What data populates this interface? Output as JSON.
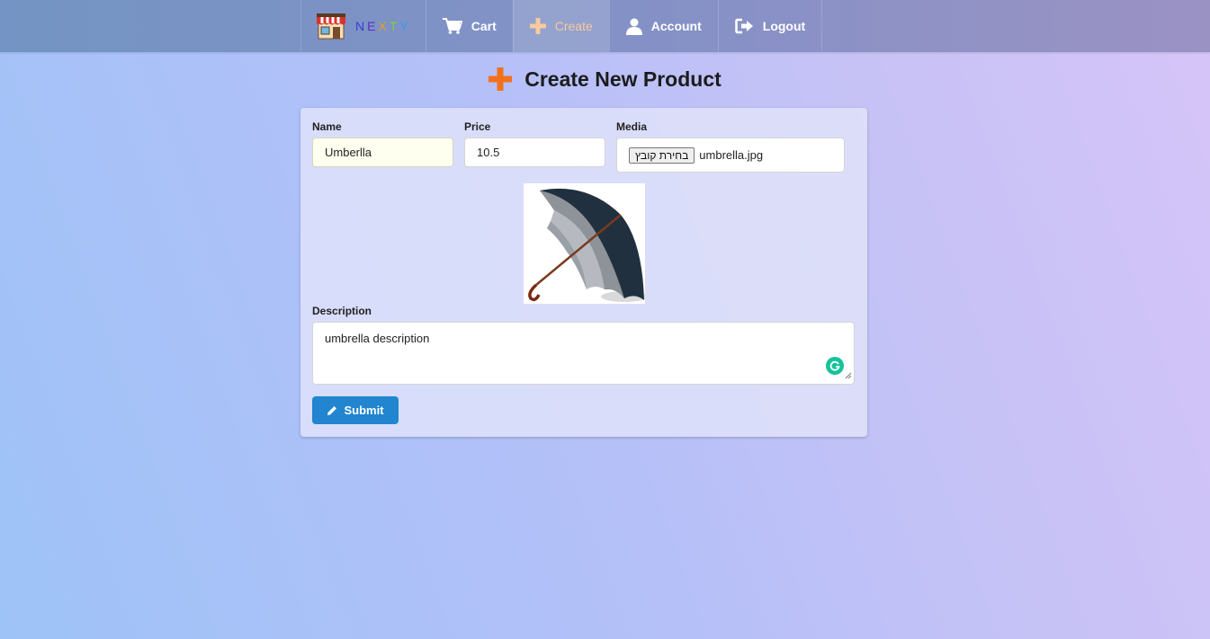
{
  "nav": {
    "brand_letters": [
      "N",
      "E",
      "X",
      "T",
      "Y"
    ],
    "items": [
      {
        "label": "Cart",
        "icon": "cart-icon"
      },
      {
        "label": "Create",
        "icon": "plus-icon",
        "active": true
      },
      {
        "label": "Account",
        "icon": "user-icon"
      },
      {
        "label": "Logout",
        "icon": "sign-out-icon"
      }
    ]
  },
  "page": {
    "title": "Create New Product"
  },
  "form": {
    "name": {
      "label": "Name",
      "value": "Umberlla"
    },
    "price": {
      "label": "Price",
      "value": "10.5"
    },
    "media": {
      "label": "Media",
      "button_label": "בחירת קובץ",
      "file_name": "umbrella.jpg"
    },
    "description": {
      "label": "Description",
      "value": "umbrella description"
    },
    "submit_label": "Submit"
  },
  "colors": {
    "accent_orange": "#f2711c",
    "submit_blue": "#2185d0",
    "grammarly_green": "#15c39a"
  }
}
